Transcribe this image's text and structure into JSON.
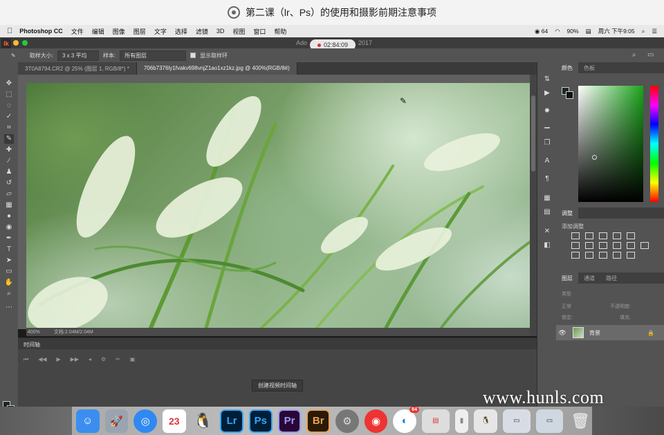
{
  "caption": {
    "title": "第二课（lr、Ps）的使用和摄影前期注意事项"
  },
  "menubar": {
    "app": "Photoshop CC",
    "items": [
      "文件",
      "编辑",
      "图像",
      "图层",
      "文字",
      "选择",
      "滤镜",
      "3D",
      "视图",
      "窗口",
      "帮助"
    ],
    "status": {
      "badge": "64",
      "battery": "90%",
      "clock": "周六 下午9:05"
    }
  },
  "window": {
    "title_left": "Ado",
    "title_right": "2017",
    "recording_time": "02:84:09"
  },
  "options": {
    "sample_size_label": "取样大小:",
    "sample_size_value": "3 x 3 平均",
    "sample_label": "样本:",
    "sample_value": "所有图层",
    "show_ring_label": "显示取样环"
  },
  "tabs": [
    {
      "label": "3T0A8794.CR2 @ 25% (图层 1, RGB/8*) *",
      "active": false
    },
    {
      "label": "706b7376ly1fvakv698vnjZ1ao1xz1kz.jpg @ 400%(RGB/8#)",
      "active": true
    }
  ],
  "document": {
    "zoom": "400%",
    "doc_info": "文档:2.04M/2.04M"
  },
  "timeline": {
    "panel_label": "时间轴",
    "create_button": "创建视频时间轴"
  },
  "panels": {
    "color_tabs": [
      "颜色",
      "色板"
    ],
    "adjust_tab": "调整",
    "adjust_label": "添加调整",
    "layers_tabs": [
      "图层",
      "通道",
      "路径"
    ],
    "layer_kind": "类型",
    "blend_mode": "正常",
    "opacity_label": "不透明度:",
    "lock_label": "锁定:",
    "fill_label": "填充:",
    "layer_name": "背景"
  },
  "dock": {
    "calendar_day": "23",
    "lr": "Lr",
    "ps": "Ps",
    "pr": "Pr",
    "br": "Br",
    "notification_badge": "64"
  },
  "watermark": "www.hunls.com",
  "colors": {
    "ps_dark": "#535353",
    "accent_lr": "#31a8ff",
    "accent_pr": "#9999ff",
    "accent_br": "#e8a15a"
  }
}
